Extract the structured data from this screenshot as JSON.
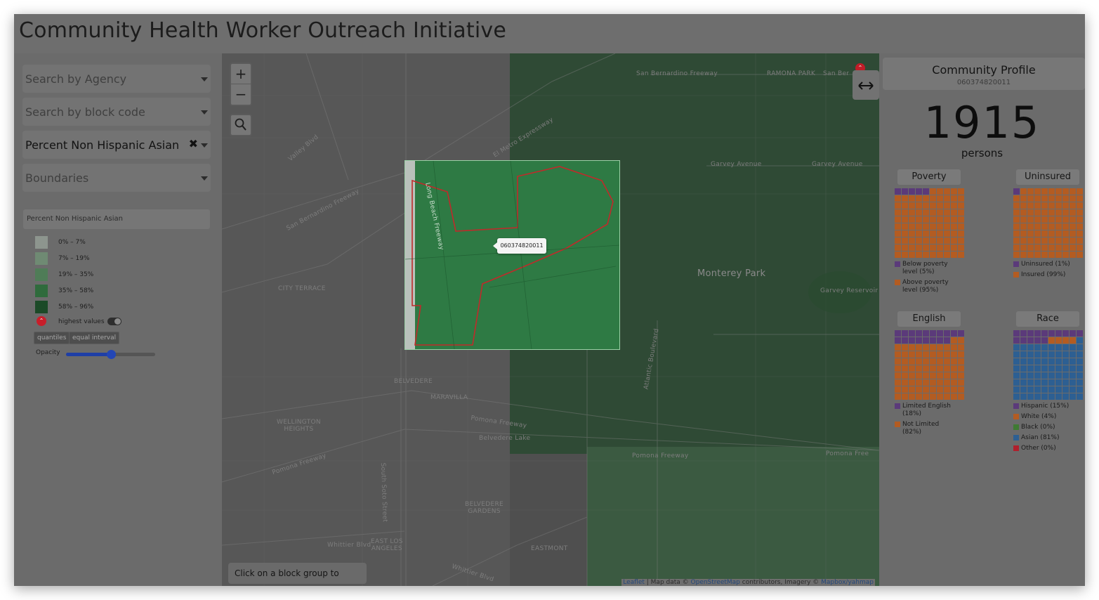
{
  "app": {
    "title": "Community Health Worker Outreach Initiative"
  },
  "sidebar": {
    "agency_placeholder": "Search by Agency",
    "block_placeholder": "Search by block code",
    "variable_selected": "Percent Non Hispanic Asian",
    "clear_symbol": "✖",
    "boundaries_placeholder": "Boundaries",
    "legend": {
      "title": "Percent Non Hispanic Asian",
      "items": [
        {
          "label": "0% – 7%",
          "color": "#8d958e"
        },
        {
          "label": "7% – 19%",
          "color": "#6f8a73"
        },
        {
          "label": "19% – 35%",
          "color": "#4f7c57"
        },
        {
          "label": "35% – 58%",
          "color": "#2f6b3c"
        },
        {
          "label": "58% – 96%",
          "color": "#1b4a27"
        }
      ],
      "highest_values_label": "highest values",
      "highest_values_icon": "⌃",
      "modes": [
        "quantiles",
        "equal interval"
      ],
      "opacity_label": "Opacity",
      "opacity_value": 0.5
    }
  },
  "map": {
    "zoom_in": "+",
    "zoom_out": "−",
    "tooltip": "060374820011",
    "hint": "Click on a block group to select it",
    "attribution_prefix": "Leaflet",
    "attribution_mid": " | Map data © ",
    "attribution_osm": "OpenStreetMap",
    "attribution_suffix": " contributors, Imagery © ",
    "attribution_mapbox": "Mapbox/yahmap",
    "labels": {
      "monterey_park": "Monterey Park",
      "city_terrace": "CITY TERRACE",
      "belvedere": "BELVEDERE",
      "maravilla": "MARAVILLA",
      "wellington_heights": "WELLINGTON\nHEIGHTS",
      "belvedere_gardens": "BELVEDERE\nGARDENS",
      "east_los_angeles": "EAST LOS\nANGELES",
      "eastmont": "EASTMONT",
      "san_bernardino_fwy": "San Bernardino Freeway",
      "ramona_park": "RAMONA PARK",
      "garvey_ave": "Garvey Avenue",
      "garvey_ave_2": "Garvey Avenue",
      "garvey_reservoir": "Garvey Reservoir",
      "pomona_fwy": "Pomona Freeway",
      "pomona_fwy_2": "Pomona Freeway",
      "pomona_fwy_3": "Pomona Freeway",
      "pomona_fwy_4": "Pomona Free",
      "long_beach_fwy": "Long Beach Freeway",
      "soto_st": "South Soto Street",
      "whittier_blvd": "Whittier Blvd",
      "whittier_blvd_2": "Whittier Blvd",
      "atlantic_blvd": "Atlantic Boulevard",
      "belvedere_lake": "Belvedere Lake",
      "el_metro": "El Metro Expressway",
      "vallejo": "Valley Blvd",
      "san_bernardino_fwy_2": "San Bernardino Freeway",
      "san_ber": "San Ber"
    }
  },
  "panel": {
    "title": "Community Profile",
    "block_code": "060374820011",
    "population": "1915",
    "population_unit": "persons",
    "charts": [
      {
        "title": "Poverty",
        "segments": [
          {
            "label": "Below poverty level (5%)",
            "percent": 5,
            "color": "#5b3a7a"
          },
          {
            "label": "Above poverty level (95%)",
            "percent": 95,
            "color": "#b35c22"
          }
        ]
      },
      {
        "title": "Uninsured",
        "segments": [
          {
            "label": "Uninsured (1%)",
            "percent": 1,
            "color": "#5b3a7a"
          },
          {
            "label": "Insured (99%)",
            "percent": 99,
            "color": "#b35c22"
          }
        ]
      },
      {
        "title": "English",
        "segments": [
          {
            "label": "Limited English (18%)",
            "percent": 18,
            "color": "#5b3a7a"
          },
          {
            "label": "Not Limited (82%)",
            "percent": 82,
            "color": "#b35c22"
          }
        ]
      },
      {
        "title": "Race",
        "segments": [
          {
            "label": "Hispanic (15%)",
            "percent": 15,
            "color": "#5b3a7a"
          },
          {
            "label": "White (4%)",
            "percent": 4,
            "color": "#b35c22"
          },
          {
            "label": "Black (0%)",
            "percent": 0,
            "color": "#3f7a33"
          },
          {
            "label": "Asian (81%)",
            "percent": 81,
            "color": "#2d5f92"
          },
          {
            "label": "Other (0%)",
            "percent": 0,
            "color": "#b01f2c"
          }
        ]
      }
    ]
  }
}
